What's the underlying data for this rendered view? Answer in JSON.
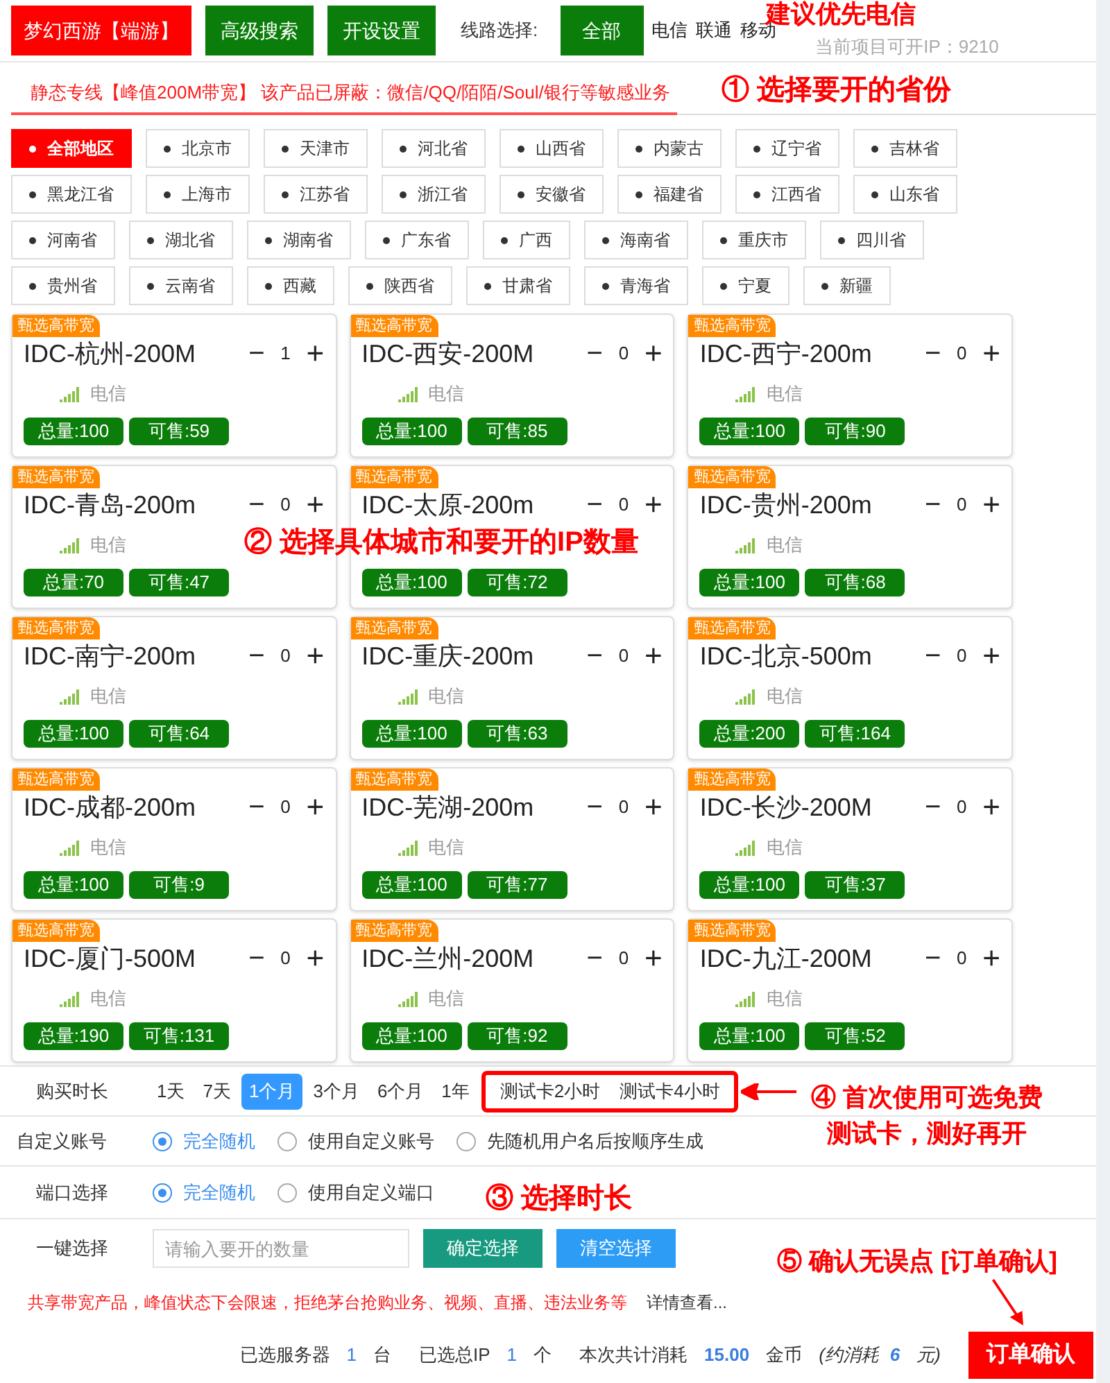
{
  "header": {
    "game_button": "梦幻西游【端游】",
    "buttons": [
      "高级搜索",
      "开设设置"
    ],
    "line_label": "线路选择:",
    "lines": [
      {
        "label": "全部",
        "selected": true
      },
      {
        "label": "电信",
        "selected": false
      },
      {
        "label": "联通",
        "selected": false
      },
      {
        "label": "移动",
        "selected": false
      }
    ],
    "available_ip": "当前项目可开IP：9210"
  },
  "notice": "静态专线【峰值200M带宽】 该产品已屏蔽：微信/QQ/陌陌/Soul/银行等敏感业务",
  "regions": [
    {
      "label": "全部地区",
      "selected": true
    },
    {
      "label": "北京市",
      "selected": false
    },
    {
      "label": "天津市",
      "selected": false
    },
    {
      "label": "河北省",
      "selected": false
    },
    {
      "label": "山西省",
      "selected": false
    },
    {
      "label": "内蒙古",
      "selected": false
    },
    {
      "label": "辽宁省",
      "selected": false
    },
    {
      "label": "吉林省",
      "selected": false
    },
    {
      "label": "黑龙江省",
      "selected": false
    },
    {
      "label": "上海市",
      "selected": false
    },
    {
      "label": "江苏省",
      "selected": false
    },
    {
      "label": "浙江省",
      "selected": false
    },
    {
      "label": "安徽省",
      "selected": false
    },
    {
      "label": "福建省",
      "selected": false
    },
    {
      "label": "江西省",
      "selected": false
    },
    {
      "label": "山东省",
      "selected": false
    },
    {
      "label": "河南省",
      "selected": false
    },
    {
      "label": "湖北省",
      "selected": false
    },
    {
      "label": "湖南省",
      "selected": false
    },
    {
      "label": "广东省",
      "selected": false
    },
    {
      "label": "广西",
      "selected": false
    },
    {
      "label": "海南省",
      "selected": false
    },
    {
      "label": "重庆市",
      "selected": false
    },
    {
      "label": "四川省",
      "selected": false
    },
    {
      "label": "贵州省",
      "selected": false
    },
    {
      "label": "云南省",
      "selected": false
    },
    {
      "label": "西藏",
      "selected": false
    },
    {
      "label": "陕西省",
      "selected": false
    },
    {
      "label": "甘肃省",
      "selected": false
    },
    {
      "label": "青海省",
      "selected": false
    },
    {
      "label": "宁夏",
      "selected": false
    },
    {
      "label": "新疆",
      "selected": false
    }
  ],
  "cards": [
    {
      "badge": "甄选高带宽",
      "name": "IDC-杭州-200M",
      "minus": "−",
      "qty": "1",
      "plus": "+",
      "carrier": "电信",
      "total": "总量:100",
      "available": "可售:59"
    },
    {
      "badge": "甄选高带宽",
      "name": "IDC-西安-200M",
      "minus": "−",
      "qty": "0",
      "plus": "+",
      "carrier": "电信",
      "total": "总量:100",
      "available": "可售:85"
    },
    {
      "badge": "甄选高带宽",
      "name": "IDC-西宁-200m",
      "minus": "−",
      "qty": "0",
      "plus": "+",
      "carrier": "电信",
      "total": "总量:100",
      "available": "可售:90"
    },
    {
      "badge": "甄选高带宽",
      "name": "IDC-青岛-200m",
      "minus": "−",
      "qty": "0",
      "plus": "+",
      "carrier": "电信",
      "total": "总量:70",
      "available": "可售:47"
    },
    {
      "badge": "甄选高带宽",
      "name": "IDC-太原-200m",
      "minus": "−",
      "qty": "0",
      "plus": "+",
      "total": "总量:100",
      "available": "可售:72"
    },
    {
      "badge": "甄选高带宽",
      "name": "IDC-贵州-200m",
      "minus": "−",
      "qty": "0",
      "plus": "+",
      "carrier": "电信",
      "total": "总量:100",
      "available": "可售:68"
    },
    {
      "badge": "甄选高带宽",
      "name": "IDC-南宁-200m",
      "minus": "−",
      "qty": "0",
      "plus": "+",
      "carrier": "电信",
      "total": "总量:100",
      "available": "可售:64"
    },
    {
      "badge": "甄选高带宽",
      "name": "IDC-重庆-200m",
      "minus": "−",
      "qty": "0",
      "plus": "+",
      "carrier": "电信",
      "total": "总量:100",
      "available": "可售:63"
    },
    {
      "badge": "甄选高带宽",
      "name": "IDC-北京-500m",
      "minus": "−",
      "qty": "0",
      "plus": "+",
      "carrier": "电信",
      "total": "总量:200",
      "available": "可售:164"
    },
    {
      "badge": "甄选高带宽",
      "name": "IDC-成都-200m",
      "minus": "−",
      "qty": "0",
      "plus": "+",
      "carrier": "电信",
      "total": "总量:100",
      "available": "可售:9"
    },
    {
      "badge": "甄选高带宽",
      "name": "IDC-芜湖-200m",
      "minus": "−",
      "qty": "0",
      "plus": "+",
      "carrier": "电信",
      "total": "总量:100",
      "available": "可售:77"
    },
    {
      "badge": "甄选高带宽",
      "name": "IDC-长沙-200M",
      "minus": "−",
      "qty": "0",
      "plus": "+",
      "carrier": "电信",
      "total": "总量:100",
      "available": "可售:37"
    },
    {
      "badge": "甄选高带宽",
      "name": "IDC-厦门-500M",
      "minus": "−",
      "qty": "0",
      "plus": "+",
      "carrier": "电信",
      "total": "总量:190",
      "available": "可售:131"
    },
    {
      "badge": "甄选高带宽",
      "name": "IDC-兰州-200M",
      "minus": "−",
      "qty": "0",
      "plus": "+",
      "carrier": "电信",
      "total": "总量:100",
      "available": "可售:92"
    },
    {
      "badge": "甄选高带宽",
      "name": "IDC-九江-200M",
      "minus": "−",
      "qty": "0",
      "plus": "+",
      "carrier": "电信",
      "total": "总量:100",
      "available": "可售:52"
    }
  ],
  "duration": {
    "label": "购买时长",
    "options": [
      {
        "label": "1天",
        "selected": false,
        "kind": "normal"
      },
      {
        "label": "7天",
        "selected": false,
        "kind": "normal"
      },
      {
        "label": "1个月",
        "selected": true,
        "kind": "normal"
      },
      {
        "label": "3个月",
        "selected": false,
        "kind": "normal"
      },
      {
        "label": "6个月",
        "selected": false,
        "kind": "normal"
      },
      {
        "label": "1年",
        "selected": false,
        "kind": "normal"
      },
      {
        "label": "测试卡2小时",
        "selected": false,
        "kind": "trial"
      },
      {
        "label": "测试卡4小时",
        "selected": false,
        "kind": "trial"
      }
    ]
  },
  "account": {
    "label": "自定义账号",
    "options": [
      {
        "label": "完全随机",
        "selected": true
      },
      {
        "label": "使用自定义账号",
        "selected": false
      },
      {
        "label": "先随机用户名后按顺序生成",
        "selected": false
      }
    ]
  },
  "port": {
    "label": "端口选择",
    "options": [
      {
        "label": "完全随机",
        "selected": true
      },
      {
        "label": "使用自定义端口",
        "selected": false
      }
    ]
  },
  "quick": {
    "label": "一键选择",
    "placeholder": "请输入要开的数量",
    "confirm": "确定选择",
    "clear": "清空选择"
  },
  "warning": "共享带宽产品，峰值状态下会限速，拒绝茅台抢购业务、视频、直播、违法业务等",
  "details_link": "详情查看...",
  "summary": {
    "servers_label": "已选服务器",
    "servers": "1",
    "servers_unit": "台",
    "ip_label": "已选总IP",
    "ip": "1",
    "ip_unit": "个",
    "cost_label": "本次共计消耗",
    "cost": "15.00",
    "cost_unit": "金币",
    "approx_label": "(约消耗",
    "approx": "6",
    "approx_unit": "元)"
  },
  "order_button": "订单确认",
  "annotations": [
    "建议优先电信",
    "① 选择要开的省份",
    "② 选择具体城市和要开的IP数量",
    "③ 选择时长",
    "④ 首次使用可选免费测试卡，测好再开",
    "⑤ 确认无误点 [订单确认]"
  ]
}
